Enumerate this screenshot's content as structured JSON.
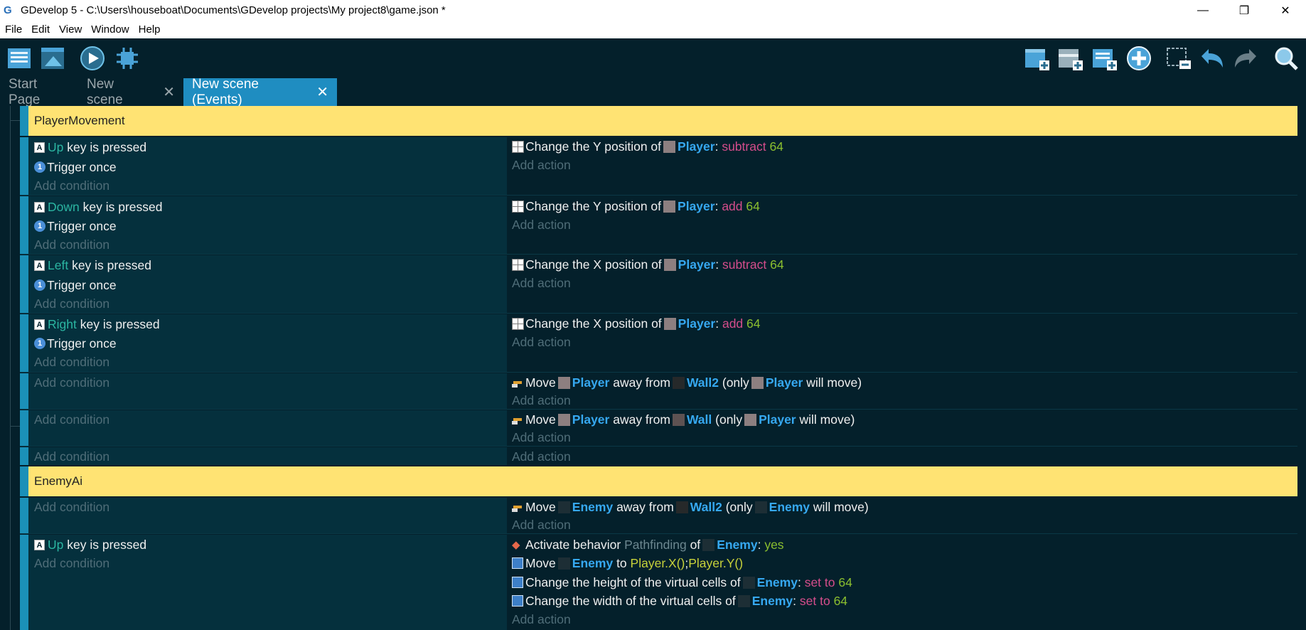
{
  "window": {
    "title": "GDevelop 5 - C:\\Users\\houseboat\\Documents\\GDevelop projects\\My project8\\game.json *",
    "minimize": "—",
    "restore": "❐",
    "close": "✕"
  },
  "menu": [
    "File",
    "Edit",
    "View",
    "Window",
    "Help"
  ],
  "tabs": [
    {
      "label": "Start Page"
    },
    {
      "label": "New scene",
      "close": "✕"
    },
    {
      "label": "New scene (Events)",
      "close": "✕"
    }
  ],
  "colors": {
    "background": "#04202b",
    "group_header": "#ffe373",
    "accent": "#1b90b8",
    "active_tab": "#1f8dc1",
    "object_name": "#36a8f0",
    "keyword": "#2bb6a2",
    "operator": "#d64d8c",
    "number": "#8bbf2f"
  },
  "text": {
    "add_condition": "Add condition",
    "add_action": "Add action",
    "key_is_pressed": "key is pressed",
    "trigger_once": "Trigger once",
    "change_y": "Change the Y position of",
    "change_x": "Change the X position of",
    "colon": ":",
    "move": "Move",
    "away_from": "away from",
    "only_open": "(only",
    "will_move": "will move)",
    "activate_behavior": "Activate behavior",
    "of": "of",
    "to": "to",
    "change_height": "Change the height of the virtual cells of",
    "change_width": "Change the width of the virtual cells of",
    "yes": "yes",
    "semicolon": ";"
  },
  "keys": {
    "up": "Up",
    "down": "Down",
    "left": "Left",
    "right": "Right"
  },
  "objects": {
    "player": "Player",
    "wall2": "Wall2",
    "wall": "Wall",
    "enemy": "Enemy"
  },
  "ops": {
    "subtract": "subtract",
    "add": "add",
    "set_to": "set to"
  },
  "values": {
    "v64": "64"
  },
  "behavior": {
    "name": "Pathfinding"
  },
  "expr": {
    "px": "Player.X()",
    "py": "Player.Y()"
  },
  "groups": {
    "player_movement": "PlayerMovement",
    "enemy_ai": "EnemyAi"
  },
  "icons": {
    "key_glyph": "A",
    "once_glyph": "1",
    "beh_glyph": "◆",
    "app_logo": "G"
  }
}
